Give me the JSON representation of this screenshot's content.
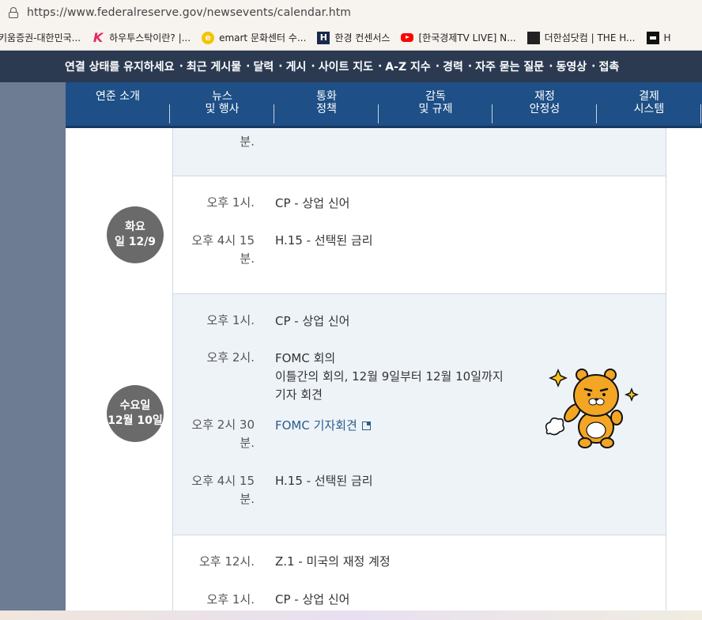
{
  "browser": {
    "url": "https://www.federalreserve.gov/newsevents/calendar.htm",
    "bookmarks": [
      {
        "label": "키움증권-대한민국...",
        "icon": "bookmark-favicon"
      },
      {
        "label": "하우투스탁이란? |...",
        "icon": "k-logo-icon"
      },
      {
        "label": "emart 문화센터 수...",
        "icon": "emart-e-icon"
      },
      {
        "label": "한경 컨센서스",
        "icon": "h-logo-icon"
      },
      {
        "label": "[한국경제TV LIVE] N...",
        "icon": "youtube-icon"
      },
      {
        "label": "더한섬닷컴 | THE H...",
        "icon": "grid-icon"
      },
      {
        "label": "H",
        "icon": "square-logo-icon"
      }
    ]
  },
  "topnav": {
    "items": [
      "연결 상태를 유지하세요",
      "최근 게시물",
      "달력",
      "게시",
      "사이트 지도",
      "A-Z 지수",
      "경력",
      "자주 묻는 질문",
      "동영상",
      "접촉"
    ]
  },
  "mainnav": {
    "tabs": [
      {
        "line1": "연준 소개",
        "line2": ""
      },
      {
        "line1": "뉴스",
        "line2": "및 행사"
      },
      {
        "line1": "통화",
        "line2": "정책"
      },
      {
        "line1": "감독",
        "line2": "및 규제"
      },
      {
        "line1": "재정",
        "line2": "안정성"
      },
      {
        "line1": "결제",
        "line2": "시스템"
      }
    ]
  },
  "calendar": {
    "partial_top": {
      "time_tail": "분."
    },
    "tuesday": {
      "day_line1": "화요",
      "day_line2": "일 12/9",
      "events": [
        {
          "time": "오후 1시.",
          "title": "CP - 상업 신어"
        },
        {
          "time_l1": "오후 4시 15",
          "time_l2": "분.",
          "title": "H.15 - 선택된 금리"
        }
      ]
    },
    "wednesday": {
      "day_line1": "수요일",
      "day_line2": "12월 10일",
      "events": [
        {
          "time": "오후 1시.",
          "title": "CP - 상업 신어"
        },
        {
          "time": "오후 2시.",
          "title": "FOMC 회의",
          "detail1": "이틀간의 회의, 12월 9일부터 12월 10일까지",
          "detail2": "기자 회견"
        },
        {
          "time_l1": "오후 2시 30",
          "time_l2": "분.",
          "title": "FOMC 기자회견"
        },
        {
          "time_l1": "오후 4시 15",
          "time_l2": "분.",
          "title": "H.15 - 선택된 금리"
        }
      ]
    },
    "thursday": {
      "events": [
        {
          "time": "오후 12시.",
          "title": "Z.1 - 미국의 재정 계정"
        },
        {
          "time": "오후 1시.",
          "title": "CP - 상업 신어"
        }
      ]
    }
  },
  "colors": {
    "topnav_bg": "#2b3a51",
    "mainnav_bg": "#1e4f86",
    "sidebar_bg": "#6d7c93",
    "shaded_row": "#eef3f8",
    "day_circle": "#6a6a6a",
    "link": "#2b5c8a"
  }
}
